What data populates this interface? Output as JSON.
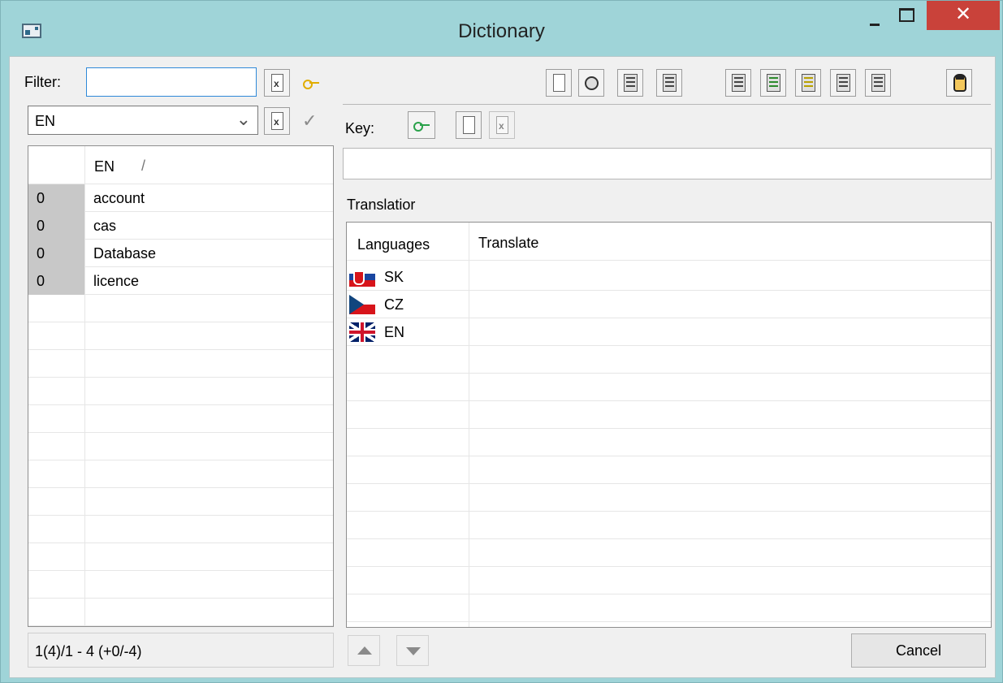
{
  "window": {
    "title": "Dictionary",
    "close_glyph": "✕"
  },
  "filter": {
    "label": "Filter:",
    "value": ""
  },
  "language_select": {
    "selected": "EN",
    "check_glyph": "✓"
  },
  "key": {
    "label": "Key:",
    "value": ""
  },
  "keys_table": {
    "header": "EN",
    "sort_indicator": "/",
    "rows": [
      {
        "count": "0",
        "key": "account"
      },
      {
        "count": "0",
        "key": "cas"
      },
      {
        "count": "0",
        "key": "Database"
      },
      {
        "count": "0",
        "key": "licence"
      }
    ]
  },
  "translation": {
    "label": "Translatior",
    "columns": [
      "Languages",
      "Translate"
    ],
    "rows": [
      {
        "lang": "SK",
        "flag": "flag-sk",
        "text": ""
      },
      {
        "lang": "CZ",
        "flag": "flag-cz",
        "text": ""
      },
      {
        "lang": "EN",
        "flag": "flag-en",
        "text": ""
      }
    ]
  },
  "status": {
    "text": "1(4)/1  -  4 (+0/-4)"
  },
  "buttons": {
    "cancel_label": "Cancel"
  }
}
